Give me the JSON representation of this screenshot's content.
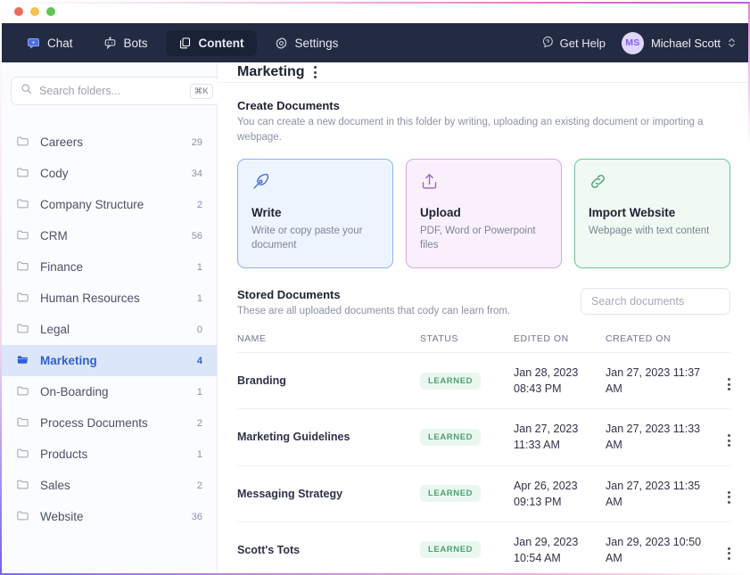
{
  "window": {
    "traffic_lights": [
      "close",
      "minimize",
      "zoom"
    ],
    "colors": {
      "nav_bg": "#232b42",
      "accent_blue": "#2563eb",
      "selected_folder_bg": "#dce6fb",
      "badge_green_bg": "#e9f8ee",
      "badge_green_text": "#4f9f72"
    }
  },
  "topnav": {
    "items": [
      {
        "label": "Chat",
        "icon": "chat-icon",
        "active": false
      },
      {
        "label": "Bots",
        "icon": "bots-icon",
        "active": false
      },
      {
        "label": "Content",
        "icon": "content-icon",
        "active": true
      },
      {
        "label": "Settings",
        "icon": "settings-gear-icon",
        "active": false
      }
    ],
    "get_help": "Get Help",
    "user": {
      "initials": "MS",
      "name": "Michael Scott"
    }
  },
  "sidebar": {
    "search": {
      "placeholder": "Search folders...",
      "value": "",
      "shortcut": "⌘K"
    },
    "add_folder_label": "add-folder",
    "folders": [
      {
        "label": "Careers",
        "count": "29",
        "selected": false
      },
      {
        "label": "Cody",
        "count": "34",
        "selected": false
      },
      {
        "label": "Company Structure",
        "count": "2",
        "selected": false
      },
      {
        "label": "CRM",
        "count": "56",
        "selected": false
      },
      {
        "label": "Finance",
        "count": "1",
        "selected": false
      },
      {
        "label": "Human Resources",
        "count": "1",
        "selected": false
      },
      {
        "label": "Legal",
        "count": "0",
        "selected": false
      },
      {
        "label": "Marketing",
        "count": "4",
        "selected": true
      },
      {
        "label": "On-Boarding",
        "count": "1",
        "selected": false
      },
      {
        "label": "Process Documents",
        "count": "2",
        "selected": false
      },
      {
        "label": "Products",
        "count": "1",
        "selected": false
      },
      {
        "label": "Sales",
        "count": "2",
        "selected": false
      },
      {
        "label": "Website",
        "count": "36",
        "selected": false
      }
    ]
  },
  "main": {
    "title": "Marketing",
    "create": {
      "heading": "Create Documents",
      "description": "You can create a new document in this folder by writing, uploading an existing document or importing a webpage.",
      "cards": [
        {
          "title": "Write",
          "desc": "Write or copy paste your document",
          "icon": "pen-quill-icon",
          "theme": "blue"
        },
        {
          "title": "Upload",
          "desc": "PDF, Word or Powerpoint files",
          "icon": "upload-arrow-icon",
          "theme": "purple"
        },
        {
          "title": "Import Website",
          "desc": "Webpage with text content",
          "icon": "link-chain-icon",
          "theme": "green"
        }
      ]
    },
    "stored": {
      "heading": "Stored Documents",
      "description": "These are all uploaded documents that cody can learn from.",
      "search": {
        "placeholder": "Search documents",
        "value": ""
      },
      "columns": [
        "NAME",
        "STATUS",
        "EDITED ON",
        "CREATED ON"
      ],
      "rows": [
        {
          "name": "Branding",
          "status": "LEARNED",
          "edited_on": "Jan 28, 2023 08:43 PM",
          "created_on": "Jan 27, 2023 11:37 AM"
        },
        {
          "name": "Marketing Guidelines",
          "status": "LEARNED",
          "edited_on": "Jan 27, 2023 11:33 AM",
          "created_on": "Jan 27, 2023 11:33 AM"
        },
        {
          "name": "Messaging Strategy",
          "status": "LEARNED",
          "edited_on": "Apr 26, 2023 09:13 PM",
          "created_on": "Jan 27, 2023 11:35 AM"
        },
        {
          "name": "Scott's Tots",
          "status": "LEARNED",
          "edited_on": "Jan 29, 2023 10:54 AM",
          "created_on": "Jan 29, 2023 10:50 AM"
        }
      ]
    }
  }
}
